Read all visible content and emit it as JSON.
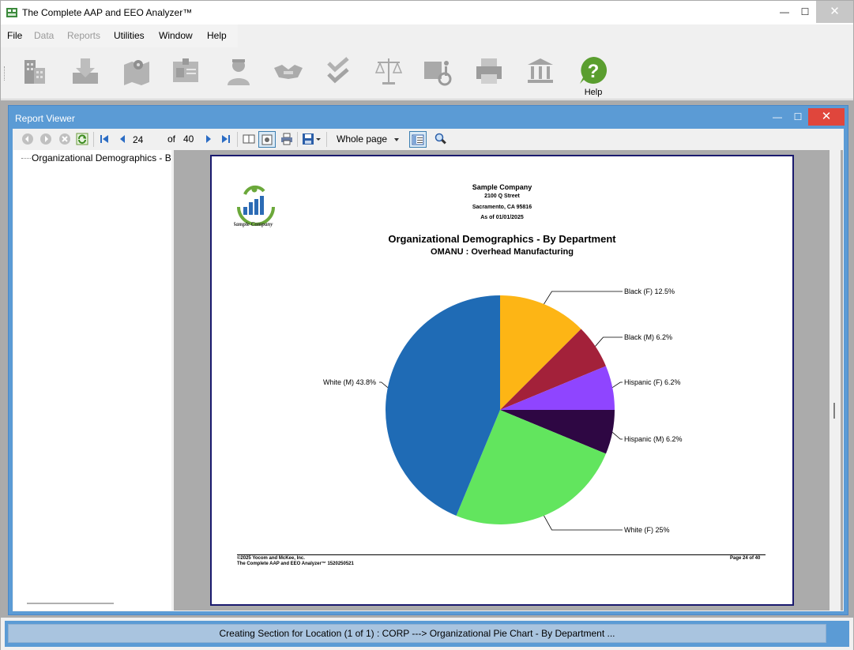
{
  "window": {
    "title": "The Complete AAP and EEO Analyzer™",
    "minimize": "—",
    "maximize": "☐",
    "close": "✕"
  },
  "menu": {
    "items": [
      {
        "label": "File",
        "enabled": true
      },
      {
        "label": "Data",
        "enabled": false
      },
      {
        "label": "Reports",
        "enabled": false
      },
      {
        "label": "Utilities",
        "enabled": true
      },
      {
        "label": "Window",
        "enabled": true
      },
      {
        "label": "Help",
        "enabled": true
      }
    ]
  },
  "toolbar": {
    "icons": [
      "buildings-icon",
      "import-icon",
      "map-icon",
      "id-card-icon",
      "person-icon",
      "handshake-icon",
      "checkmark-icon",
      "scales-icon",
      "disability-icon",
      "printer-icon",
      "bank-icon",
      "help-icon"
    ],
    "help_label": "Help",
    "help_color": "#5a9e2f"
  },
  "report_viewer": {
    "title": "Report Viewer",
    "page_number": "24",
    "of_label": "of",
    "page_total": "40",
    "zoom": "Whole page",
    "tree_item": "Organizational Demographics - By Department"
  },
  "report": {
    "company": "Sample Company",
    "street": "2100 Q Street",
    "city": "Sacramento, CA 95816",
    "as_of": "As of 01/01/2025",
    "logo_caption": "Sample Company",
    "title": "Organizational Demographics - By Department",
    "subtitle": "OMANU : Overhead Manufacturing",
    "footer_copyright": "©2025 Yocom and McKee, Inc.",
    "footer_product": "The Complete AAP and EEO Analyzer™ 1520250521",
    "footer_page": "Page 24 of 40"
  },
  "chart_data": {
    "type": "pie",
    "title": "Organizational Demographics - By Department",
    "subtitle": "OMANU : Overhead Manufacturing",
    "slices": [
      {
        "label": "Black (F) 12.5%",
        "value": 12.5,
        "color": "#fdb515"
      },
      {
        "label": "Black (M) 6.2%",
        "value": 6.25,
        "color": "#a3213a"
      },
      {
        "label": "Hispanic (F) 6.2%",
        "value": 6.25,
        "color": "#8f45ff"
      },
      {
        "label": "Hispanic (M) 6.2%",
        "value": 6.25,
        "color": "#2e0743"
      },
      {
        "label": "White (F) 25%",
        "value": 25,
        "color": "#62e55e"
      },
      {
        "label": "White (M) 43.8%",
        "value": 43.75,
        "color": "#1f6bb5"
      }
    ]
  },
  "status": {
    "text": "Creating Section for Location (1 of 1) : CORP ---> Organizational Pie Chart - By Department ..."
  }
}
